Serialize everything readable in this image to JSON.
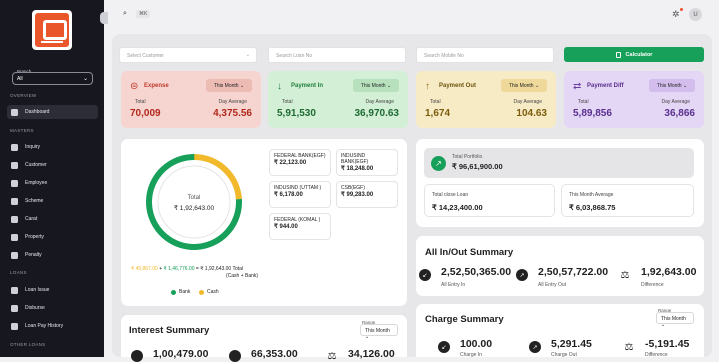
{
  "sidebar": {
    "branch_label": "Branch",
    "branch_value": "All",
    "sections": {
      "overview": "OVERVIEW",
      "masters": "MASTERS",
      "loans": "LOANS",
      "other_loans": "OTHER LOANS"
    },
    "items": [
      {
        "label": "Dashboard",
        "icon": "dashboard-icon"
      },
      {
        "label": "Inquiry",
        "icon": "inquiry-icon"
      },
      {
        "label": "Customer",
        "icon": "customer-icon"
      },
      {
        "label": "Employee",
        "icon": "employee-icon"
      },
      {
        "label": "Scheme",
        "icon": "scheme-icon"
      },
      {
        "label": "Carat",
        "icon": "carat-icon"
      },
      {
        "label": "Property",
        "icon": "property-icon"
      },
      {
        "label": "Penalty",
        "icon": "penalty-icon"
      },
      {
        "label": "Loan Issue",
        "icon": "loan-issue-icon"
      },
      {
        "label": "Disburse",
        "icon": "disburse-icon"
      },
      {
        "label": "Loan Pay History",
        "icon": "history-icon"
      }
    ]
  },
  "topbar": {
    "search_shortcut": "⌘K",
    "avatar_letter": "U"
  },
  "filters": {
    "customer_placeholder": "Select Customer",
    "loan_placeholder": "Search Loan No",
    "mobile_placeholder": "Search Mobile No",
    "calculator_label": "Calculator"
  },
  "cards": [
    {
      "title": "Expense",
      "range": "This Month",
      "total_label": "Total",
      "avg_label": "Day Average",
      "total": "70,009",
      "avg": "4,375.56",
      "bg": "#f6d5d1",
      "accent": "#c0392b",
      "icon": "expense-icon"
    },
    {
      "title": "Payment In",
      "range": "This Month",
      "total_label": "Total",
      "avg_label": "Day Average",
      "total": "5,91,530",
      "avg": "36,970.63",
      "bg": "#d3efd6",
      "accent": "#1e7d3a",
      "icon": "arrow-down-icon"
    },
    {
      "title": "Payment Out",
      "range": "This Month",
      "total_label": "Total",
      "avg_label": "Day Average",
      "total": "1,674",
      "avg": "104.63",
      "bg": "#f7ebc6",
      "accent": "#8a6a12",
      "icon": "arrow-up-icon"
    },
    {
      "title": "Payment Diff",
      "range": "This Month",
      "total_label": "Total",
      "avg_label": "Day Average",
      "total": "5,89,856",
      "avg": "36,866",
      "bg": "#e4d6f5",
      "accent": "#6b3fa0",
      "icon": "diff-icon"
    }
  ],
  "donut": {
    "center_label": "Total",
    "center_value": "₹ 1,92,643.00",
    "bank_fraction": 0.76,
    "summary_cash": "₹ 45,867.00",
    "summary_bank": "₹ 1,46,776.00",
    "summary_total": "₹ 1,92,643.00 Total",
    "summary_sub": "(Cash + Bank)",
    "legend_bank": "Bank",
    "legend_cash": "Cash"
  },
  "banks": [
    {
      "name": "FEDERAL BANK(EGF)",
      "amount": "₹ 22,123.00"
    },
    {
      "name": "INDUSIND BANK(EGF)",
      "amount": "₹ 18,248.00"
    },
    {
      "name": "INDUSIND (UTTAM )",
      "amount": "₹ 6,178.00"
    },
    {
      "name": "CSB(EGF)",
      "amount": "₹ 99,283.00"
    },
    {
      "name": "FEDERAL (KOMAL )",
      "amount": "₹ 944.00"
    }
  ],
  "portfolio": {
    "label": "Total Portfolio",
    "value": "₹ 96,61,900.00",
    "close_label": "Total close Loan",
    "close_value": "₹ 14,23,400.00",
    "avg_label": "This Month Average",
    "avg_value": "₹ 6,03,868.75"
  },
  "inout": {
    "title": "All In/Out Summary",
    "stats": [
      {
        "value": "2,52,50,365.00",
        "label": "All Entry In"
      },
      {
        "value": "2,50,57,722.00",
        "label": "All Entry Out"
      },
      {
        "value": "1,92,643.00",
        "label": "Difference"
      }
    ]
  },
  "interest": {
    "title": "Interest Summary",
    "range_label": "Range",
    "range": "This Month",
    "values": [
      "1,00,479.00",
      "66,353.00",
      "34,126.00"
    ]
  },
  "charge": {
    "title": "Charge Summary",
    "range_label": "Range",
    "range": "This Month",
    "values": [
      "100.00",
      "5,291.45",
      "-5,191.45"
    ],
    "labels": [
      "Charge In",
      "Charge Out",
      "Difference"
    ]
  },
  "colors": {
    "bank": "#16a05a",
    "cash": "#f2b92b",
    "sidebar": "#16171f"
  }
}
